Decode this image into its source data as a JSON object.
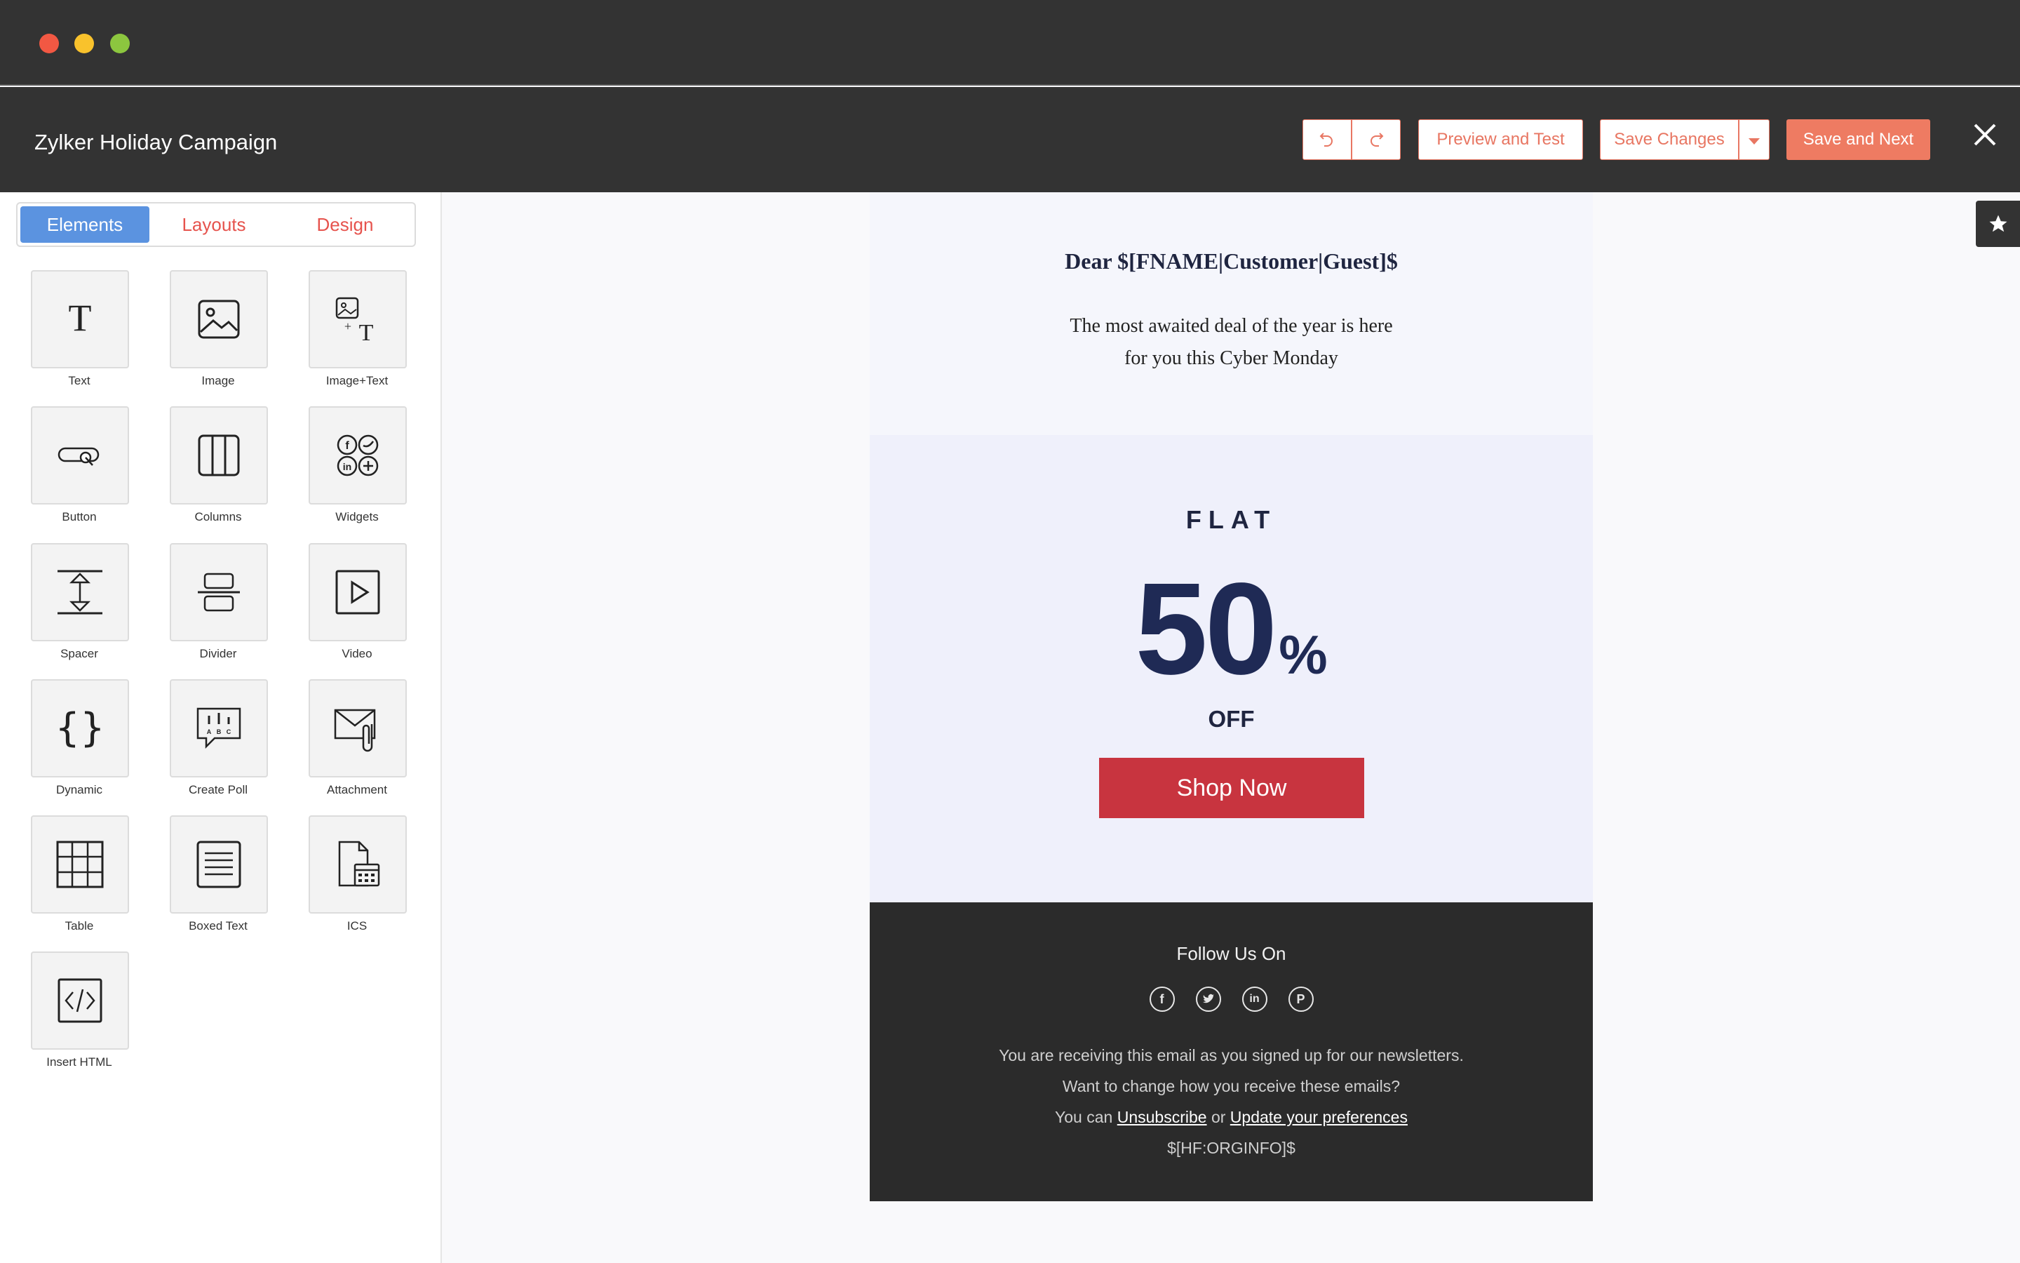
{
  "window": {
    "colors": {
      "close": "#f25843",
      "minimize": "#f9c22c",
      "zoom": "#8cc63f"
    }
  },
  "header": {
    "title": "Zylker Holiday Campaign",
    "undo_icon": "undo-icon",
    "redo_icon": "redo-icon",
    "preview_label": "Preview and Test",
    "save_label": "Save Changes",
    "save_next_label": "Save and Next",
    "accent": "#ee7b62"
  },
  "sidebar": {
    "tabs": [
      {
        "label": "Elements",
        "active": true
      },
      {
        "label": "Layouts",
        "active": false
      },
      {
        "label": "Design",
        "active": false
      }
    ],
    "elements": [
      {
        "label": "Text",
        "icon": "text-icon"
      },
      {
        "label": "Image",
        "icon": "image-icon"
      },
      {
        "label": "Image+Text",
        "icon": "image-text-icon"
      },
      {
        "label": "Button",
        "icon": "button-icon"
      },
      {
        "label": "Columns",
        "icon": "columns-icon"
      },
      {
        "label": "Widgets",
        "icon": "widgets-icon"
      },
      {
        "label": "Spacer",
        "icon": "spacer-icon"
      },
      {
        "label": "Divider",
        "icon": "divider-icon"
      },
      {
        "label": "Video",
        "icon": "video-icon"
      },
      {
        "label": "Dynamic",
        "icon": "dynamic-icon"
      },
      {
        "label": "Create Poll",
        "icon": "poll-icon"
      },
      {
        "label": "Attachment",
        "icon": "attachment-icon"
      },
      {
        "label": "Table",
        "icon": "table-icon"
      },
      {
        "label": "Boxed Text",
        "icon": "boxed-text-icon"
      },
      {
        "label": "ICS",
        "icon": "ics-icon"
      },
      {
        "label": "Insert HTML",
        "icon": "html-icon"
      }
    ]
  },
  "email": {
    "greeting": "Dear $[FNAME|Customer|Guest]$",
    "intro_line1": "The most awaited deal of the year is here",
    "intro_line2": "for you this Cyber Monday",
    "flat": "FLAT",
    "discount": "50",
    "percent": "%",
    "off": "OFF",
    "cta": "Shop Now",
    "cta_color": "#c8343f",
    "footer": {
      "follow": "Follow Us On",
      "socials": [
        "facebook-icon",
        "twitter-icon",
        "linkedin-icon",
        "pinterest-icon"
      ],
      "line1": "You are receiving this email as you signed up for our newsletters.",
      "line2": "Want to change how you receive these emails?",
      "line3_prefix": "You can",
      "unsubscribe": "Unsubscribe",
      "line3_or": "or",
      "update_prefs": "Update your preferences",
      "org_info": "$[HF:ORGINFO]$"
    }
  }
}
